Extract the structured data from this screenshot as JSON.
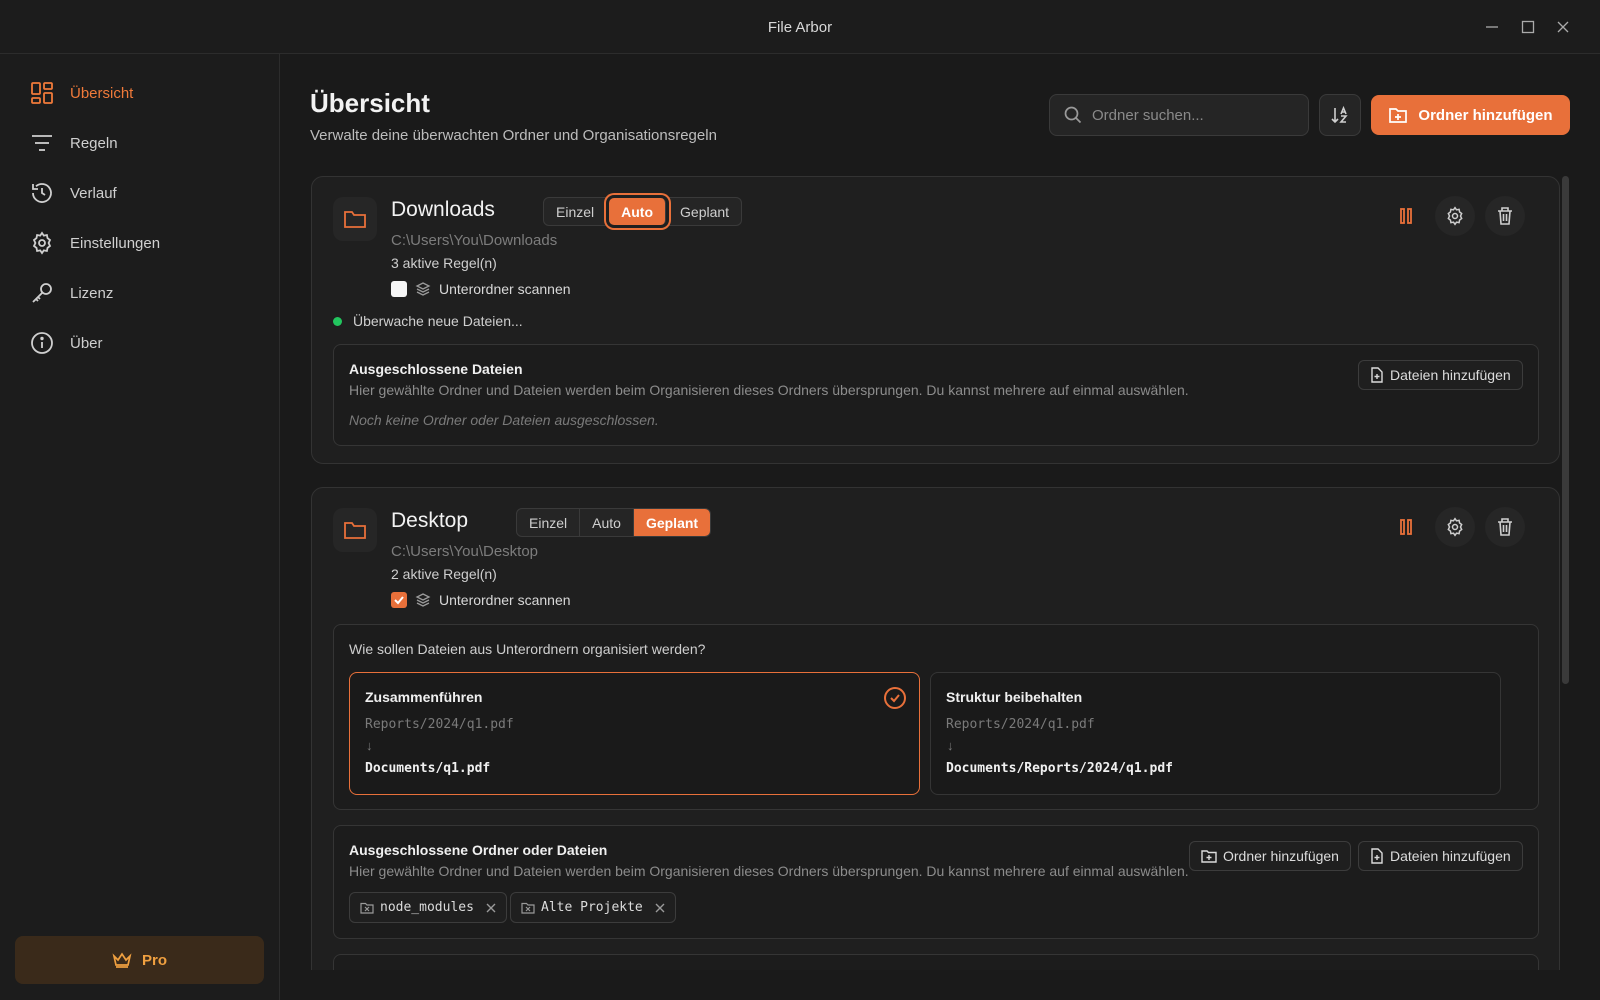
{
  "app": {
    "title": "File Arbor"
  },
  "window": {
    "minimize": "minimize",
    "maximize": "maximize",
    "close": "close"
  },
  "sidebar": {
    "items": [
      {
        "label": "Übersicht",
        "icon": "grid-icon",
        "active": true
      },
      {
        "label": "Regeln",
        "icon": "filter-icon",
        "active": false
      },
      {
        "label": "Verlauf",
        "icon": "history-icon",
        "active": false
      },
      {
        "label": "Einstellungen",
        "icon": "gear-icon",
        "active": false
      },
      {
        "label": "Lizenz",
        "icon": "key-icon",
        "active": false
      },
      {
        "label": "Über",
        "icon": "info-icon",
        "active": false
      }
    ],
    "pro_label": "Pro"
  },
  "header": {
    "title": "Übersicht",
    "subtitle": "Verwalte deine überwachten Ordner und Organisationsregeln",
    "search_placeholder": "Ordner suchen...",
    "add_folder_label": "Ordner hinzufügen"
  },
  "folders": [
    {
      "name": "Downloads",
      "path": "C:\\Users\\You\\Downloads",
      "rules": "3 aktive Regel(n)",
      "modes": [
        "Einzel",
        "Auto",
        "Geplant"
      ],
      "active_mode": "Auto",
      "scan_subfolders_label": "Unterordner scannen",
      "scan_subfolders": false,
      "status": "Überwache neue Dateien...",
      "excluded": {
        "title": "Ausgeschlossene Dateien",
        "desc": "Hier gewählte Ordner und Dateien werden beim Organisieren dieses Ordners übersprungen. Du kannst mehrere auf einmal auswählen.",
        "empty": "Noch keine Ordner oder Dateien ausgeschlossen.",
        "add_files": "Dateien hinzufügen"
      }
    },
    {
      "name": "Desktop",
      "path": "C:\\Users\\You\\Desktop",
      "rules": "2 aktive Regel(n)",
      "modes": [
        "Einzel",
        "Auto",
        "Geplant"
      ],
      "active_mode": "Geplant",
      "scan_subfolders_label": "Unterordner scannen",
      "scan_subfolders": true,
      "subfolder_question": "Wie sollen Dateien aus Unterordnern organisiert werden?",
      "options": [
        {
          "title": "Zusammenführen",
          "src": "Reports/2024/q1.pdf",
          "arrow": "↓",
          "dst": "Documents/q1.pdf",
          "selected": true
        },
        {
          "title": "Struktur beibehalten",
          "src": "Reports/2024/q1.pdf",
          "arrow": "↓",
          "dst": "Documents/Reports/2024/q1.pdf",
          "selected": false
        }
      ],
      "excluded": {
        "title": "Ausgeschlossene Ordner oder Dateien",
        "desc": "Hier gewählte Ordner und Dateien werden beim Organisieren dieses Ordners übersprungen. Du kannst mehrere auf einmal auswählen.",
        "add_folders": "Ordner hinzufügen",
        "add_files": "Dateien hinzufügen",
        "items": [
          "node_modules",
          "Alte Projekte"
        ]
      }
    }
  ],
  "colors": {
    "accent": "#e8703a",
    "status_ok": "#22c55e",
    "pro": "#f0a040"
  }
}
